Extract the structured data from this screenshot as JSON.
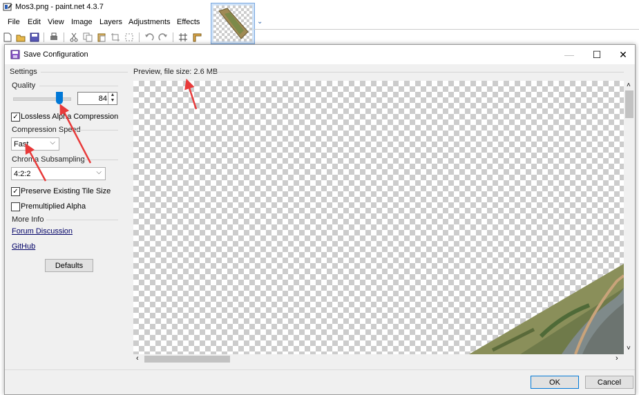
{
  "app": {
    "title": "Mos3.png - paint.net 4.3.7",
    "menu": [
      "File",
      "Edit",
      "View",
      "Image",
      "Layers",
      "Adjustments",
      "Effects"
    ]
  },
  "dialog": {
    "title": "Save Configuration",
    "settings_group": "Settings",
    "quality_label": "Quality",
    "quality_value": "84",
    "quality_fraction": 0.84,
    "lossless_alpha": {
      "label": "Lossless Alpha Compression",
      "checked": true
    },
    "compression_speed": {
      "label": "Compression Speed",
      "value": "Fast"
    },
    "chroma_subsampling": {
      "label": "Chroma Subsampling",
      "value": "4:2:2"
    },
    "preserve_tile": {
      "label": "Preserve Existing Tile Size",
      "checked": true
    },
    "premultiplied_alpha": {
      "label": "Premultiplied Alpha",
      "checked": false
    },
    "more_info_group": "More Info",
    "forum_link": "Forum Discussion",
    "github_link": "GitHub",
    "defaults_button": "Defaults",
    "preview_label": "Preview, file size: 2.6 MB",
    "ok_button": "OK",
    "cancel_button": "Cancel"
  },
  "colors": {
    "accent": "#0078d7",
    "annotation_arrow": "#e83a3a"
  }
}
